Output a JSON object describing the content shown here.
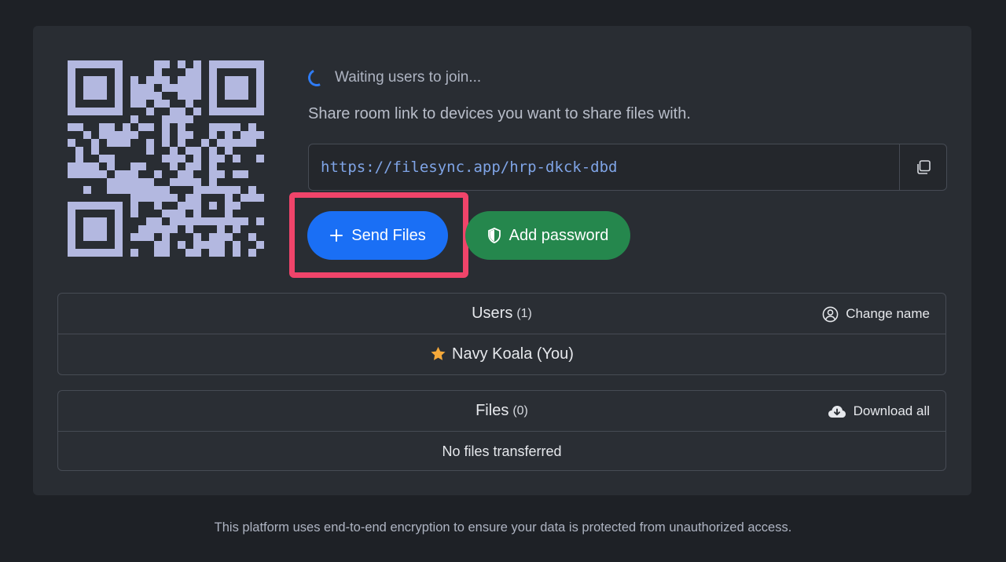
{
  "status": {
    "waiting_text": "Waiting users to join..."
  },
  "share": {
    "instruction": "Share room link to devices you want to share files with.",
    "room_link": "https://filesync.app/hrp-dkck-dbd"
  },
  "actions": {
    "send_files_label": "Send Files",
    "add_password_label": "Add password"
  },
  "users_panel": {
    "title": "Users",
    "count": "(1)",
    "change_name_label": "Change name",
    "users": [
      {
        "name": "Navy Koala (You)",
        "icon": "star-icon"
      }
    ]
  },
  "files_panel": {
    "title": "Files",
    "count": "(0)",
    "download_all_label": "Download all",
    "empty_text": "No files transferred"
  },
  "footer": {
    "text": "This platform uses end-to-end encryption to ensure your data is protected from unauthorized access."
  },
  "colors": {
    "background": "#1e2126",
    "card": "#292d33",
    "primary_blue": "#1a6ff5",
    "success_green": "#25874d",
    "highlight_pink": "#f0446a",
    "qr_color": "#b3b8e0",
    "star": "#f5a93a"
  }
}
